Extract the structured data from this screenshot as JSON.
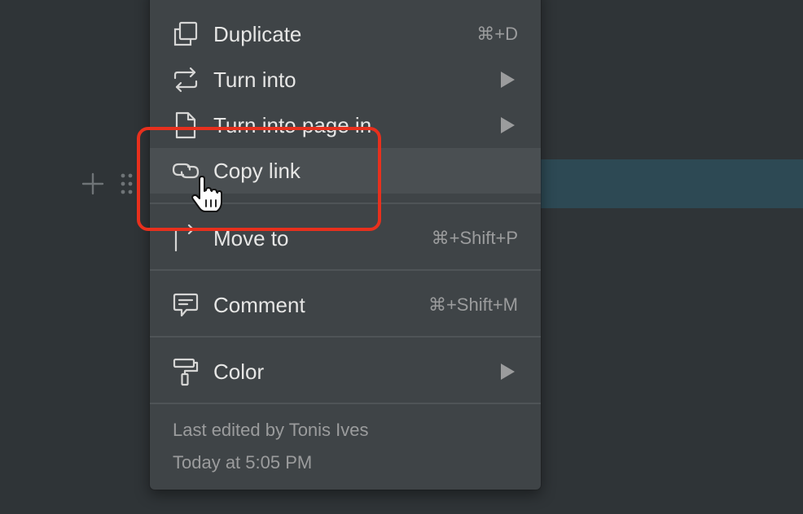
{
  "menu": {
    "items": [
      {
        "label": "Duplicate",
        "shortcut": "⌘+D",
        "icon": "duplicate-icon"
      },
      {
        "label": "Turn into",
        "icon": "turn-into-icon",
        "submenu": true
      },
      {
        "label": "Turn into page in",
        "icon": "page-icon",
        "submenu": true
      },
      {
        "label": "Copy link",
        "icon": "link-icon",
        "hovered": true
      },
      {
        "label": "Move to",
        "shortcut": "⌘+Shift+P",
        "icon": "move-to-icon"
      },
      {
        "label": "Comment",
        "shortcut": "⌘+Shift+M",
        "icon": "comment-icon"
      },
      {
        "label": "Color",
        "icon": "paint-roller-icon",
        "submenu": true
      }
    ],
    "footer": {
      "last_edited": "Last edited by Tonis Ives",
      "timestamp": "Today at 5:05 PM"
    }
  },
  "colors": {
    "page_background": "#2f3437",
    "menu_background": "#3f4447",
    "hover_background": "#4a4f52",
    "selected_block": "#2d4954",
    "annotation": "#e8301d",
    "text_primary": "#e6e6e5",
    "text_secondary": "#9b9c9d"
  }
}
